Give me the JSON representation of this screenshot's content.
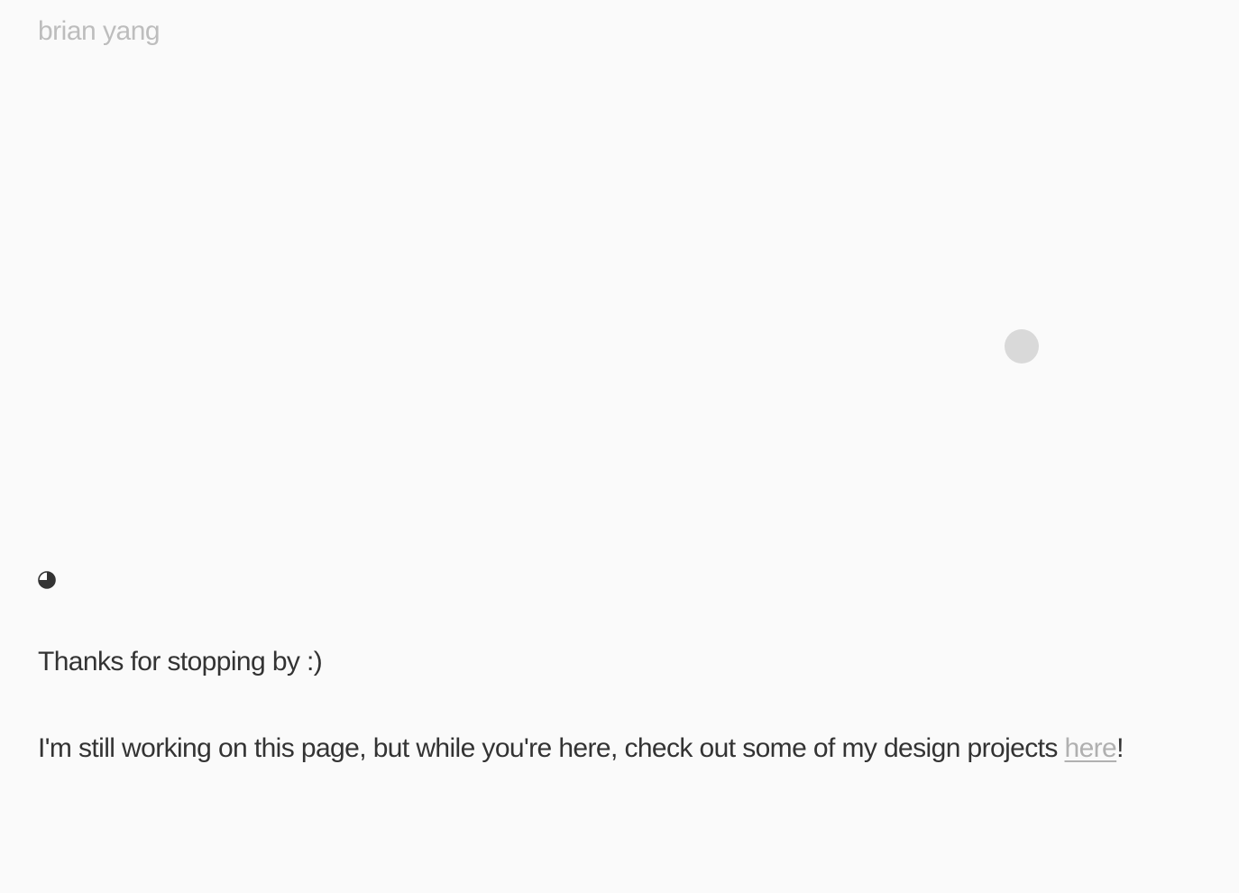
{
  "header": {
    "site_name": "brian yang"
  },
  "theme_toggle": {
    "icon": "circle-half-icon",
    "color": "#333333"
  },
  "content": {
    "thanks": "Thanks for stopping by :)",
    "message_before_link": "I'm still working on this page, but while you're here, check out some of my design projects ",
    "link_label": "here",
    "message_after_link": "!"
  },
  "colors": {
    "background": "#fafafa",
    "text": "#333333",
    "muted": "#bdbdbd",
    "link": "#b0b0b0",
    "cursor_dot": "#d9d9d9"
  }
}
